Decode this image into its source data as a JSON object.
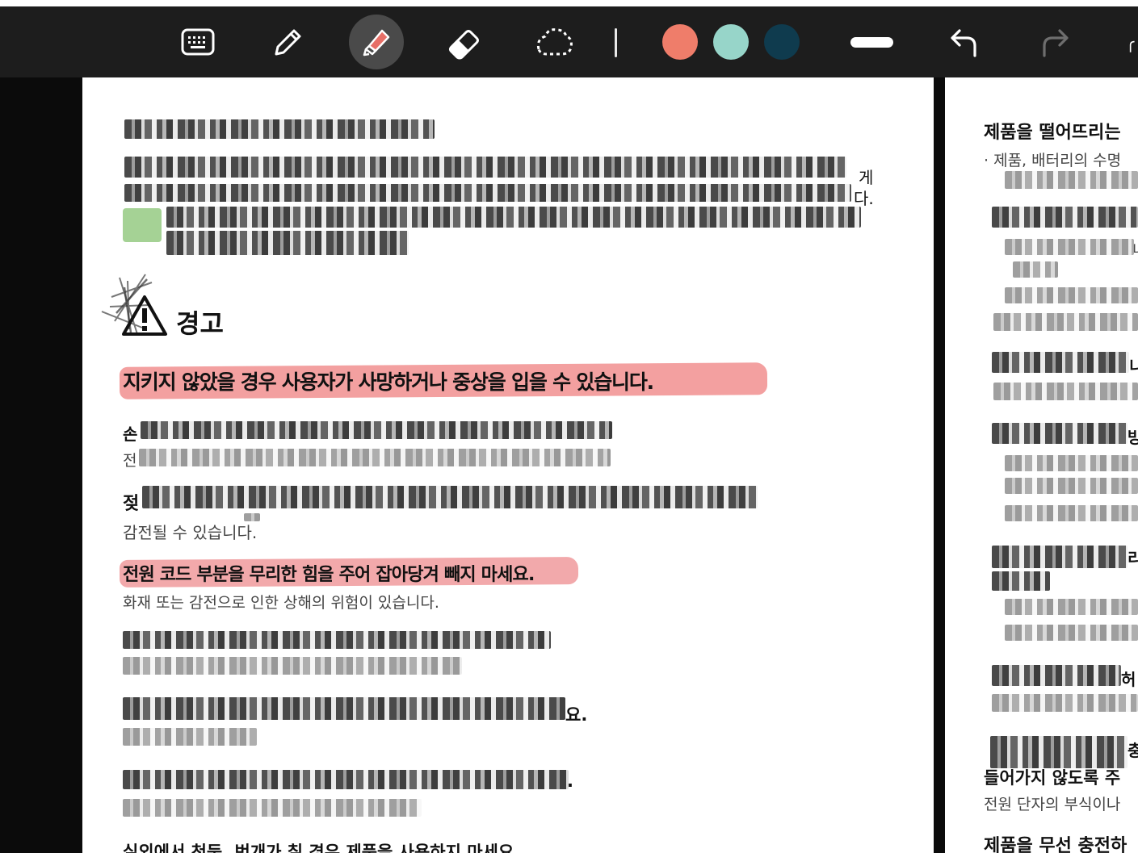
{
  "toolbar": {
    "tools": [
      {
        "name": "keyboard-icon"
      },
      {
        "name": "pen-icon"
      },
      {
        "name": "highlighter-icon",
        "active": true
      },
      {
        "name": "eraser-icon"
      },
      {
        "name": "lasso-icon"
      }
    ],
    "colors": [
      "#ef7d6a",
      "#97d5c9",
      "#0f3b4e"
    ],
    "stroke": "thick",
    "undo_icon": "undo-icon",
    "redo_icon": "redo-icon"
  },
  "left_page": {
    "warning_heading": "경고",
    "warning_subtitle": "지키지 않았을 경우 사용자가 사망하거나 중상을 입을 수 있습니다.",
    "frag_ge": "게",
    "frag_da": "다.",
    "frag_son": "손",
    "frag_jeon": "전",
    "frag_jeot": "젖",
    "shock_text": "감전될 수 있습니다.",
    "cord_title": "전원 코드 부분을 무리한 힘을 주어 잡아당겨 빼지 마세요.",
    "cord_desc": "화재 또는 감전으로 인한 상해의 위험이 있습니다.",
    "frag_yo": "요.",
    "frag_period": ".",
    "bottom_title": "실외에서 천둥, 번개가 칠 경우 제품을 사용하지 마세요."
  },
  "right_page": {
    "drop_title": "제품을 떨어뜨리는",
    "drop_bullet": "제품, 배터리의 수명",
    "frag1": "니",
    "frag2": "니",
    "frag3": "방",
    "frag4": "리",
    "frag5": "허",
    "frag6": "충",
    "insert_text": "들어가지 않도록 주",
    "terminal_text": "전원 단자의 부식이나",
    "wireless_title": "제품을 무선 충전하"
  }
}
